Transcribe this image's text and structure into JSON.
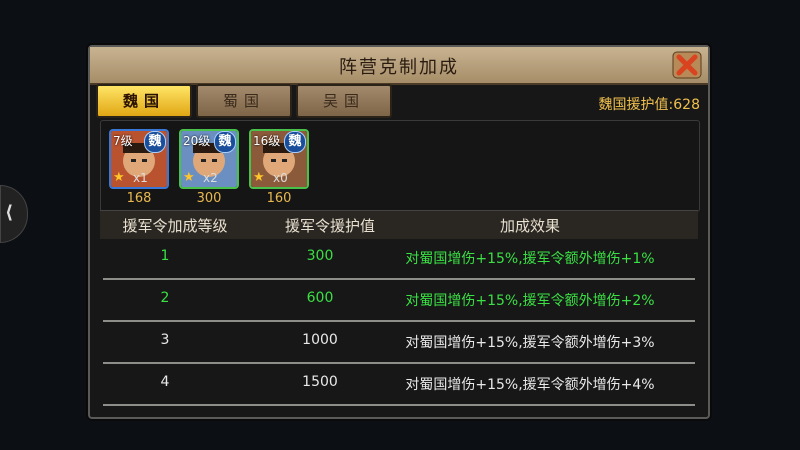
{
  "panel": {
    "title": "阵营克制加成",
    "close_icon": "close-x-icon",
    "tabs": [
      {
        "label": "魏国",
        "active": true
      },
      {
        "label": "蜀国",
        "active": false
      },
      {
        "label": "吴国",
        "active": false
      }
    ],
    "assist_value_text": "魏国援护值:628"
  },
  "heroes": [
    {
      "level": "7级",
      "faction": "魏",
      "count": "x1",
      "stars": 1,
      "value": "168",
      "border": "#3a78d8"
    },
    {
      "level": "20级",
      "faction": "魏",
      "count": "x2",
      "stars": 1,
      "value": "300",
      "border": "#48c24a"
    },
    {
      "level": "16级",
      "faction": "魏",
      "count": "x0",
      "stars": 1,
      "value": "160",
      "border": "#48c24a"
    }
  ],
  "table": {
    "headers": [
      "援军令加成等级",
      "援军令援护值",
      "加成效果"
    ],
    "rows": [
      {
        "level": "1",
        "value": "300",
        "effect": "对蜀国增伤+15%,援军令额外增伤+1%",
        "active": true
      },
      {
        "level": "2",
        "value": "600",
        "effect": "对蜀国增伤+15%,援军令额外增伤+2%",
        "active": true
      },
      {
        "level": "3",
        "value": "1000",
        "effect": "对蜀国增伤+15%,援军令额外增伤+3%",
        "active": false
      },
      {
        "level": "4",
        "value": "1500",
        "effect": "对蜀国增伤+15%,援军令额外增伤+4%",
        "active": false
      }
    ]
  },
  "colors": {
    "active_text": "#3ae044",
    "inactive_text": "#e9e9e9",
    "accent_gold": "#f1c04d"
  }
}
